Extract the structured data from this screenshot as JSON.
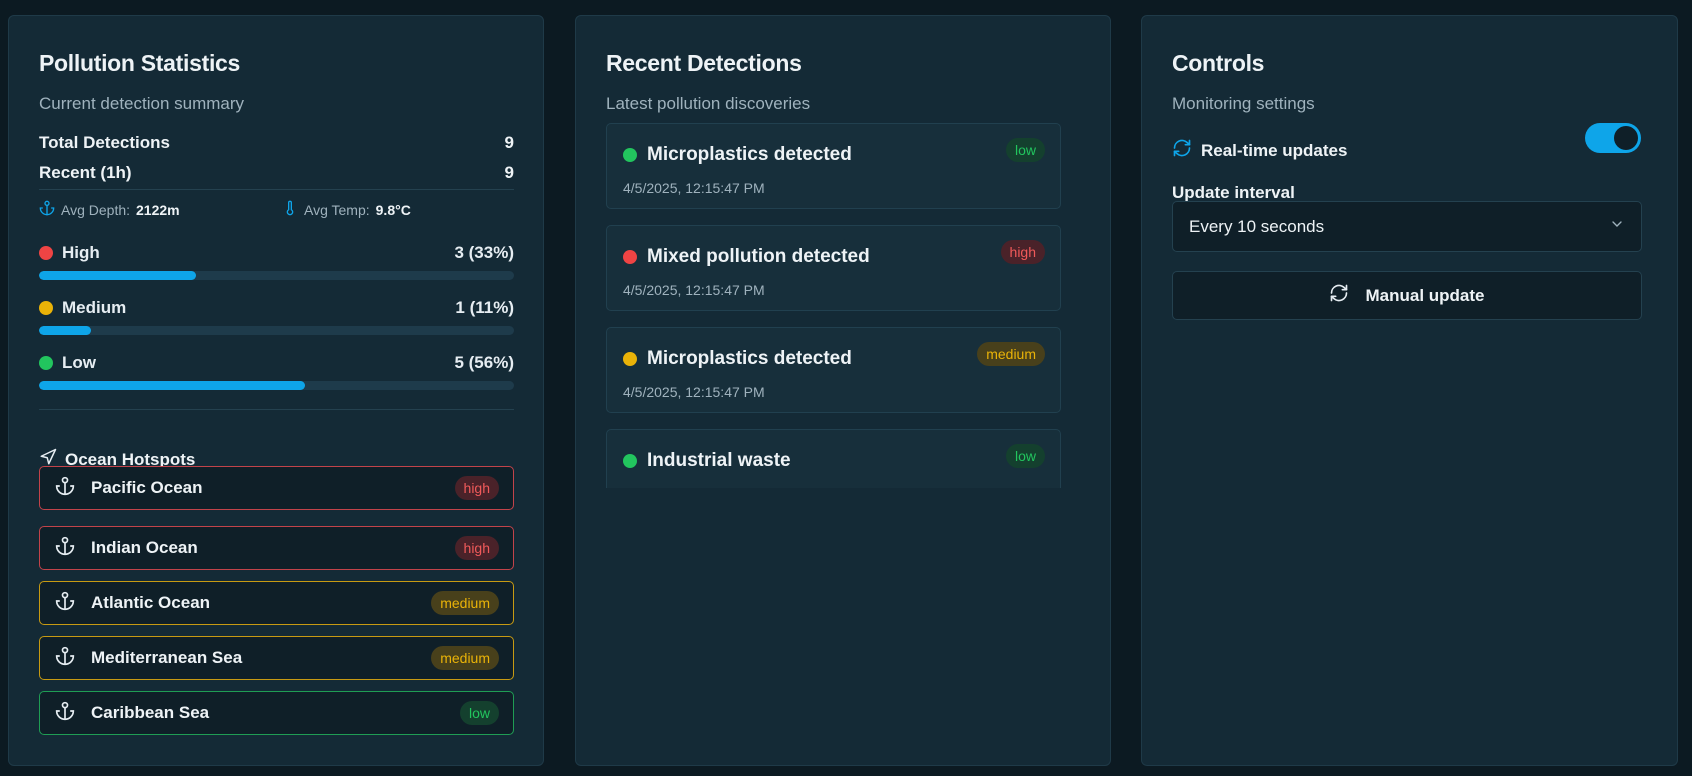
{
  "stats": {
    "title": "Pollution Statistics",
    "subtitle": "Current detection summary",
    "total_label": "Total Detections",
    "total_value": "9",
    "recent_label": "Recent (1h)",
    "recent_value": "9",
    "avg_depth_label": "Avg Depth:",
    "avg_depth_value": "2122m",
    "avg_temp_label": "Avg Temp:",
    "avg_temp_value": "9.8°C",
    "severity": [
      {
        "name": "High",
        "count": "3 (33%)",
        "fraction": 0.33,
        "color": "#ef4444"
      },
      {
        "name": "Medium",
        "count": "1 (11%)",
        "fraction": 0.11,
        "color": "#eab308"
      },
      {
        "name": "Low",
        "count": "5 (56%)",
        "fraction": 0.56,
        "color": "#22c55e"
      }
    ],
    "hotspots_title": "Ocean Hotspots",
    "hotspots": [
      {
        "name": "Pacific Ocean",
        "level": "high"
      },
      {
        "name": "Indian Ocean",
        "level": "high"
      },
      {
        "name": "Atlantic Ocean",
        "level": "medium"
      },
      {
        "name": "Mediterranean Sea",
        "level": "medium"
      },
      {
        "name": "Caribbean Sea",
        "level": "low"
      }
    ]
  },
  "detections": {
    "title": "Recent Detections",
    "subtitle": "Latest pollution discoveries",
    "items": [
      {
        "title": "Microplastics detected",
        "time": "4/5/2025, 12:15:47 PM",
        "level": "low"
      },
      {
        "title": "Mixed pollution detected",
        "time": "4/5/2025, 12:15:47 PM",
        "level": "high"
      },
      {
        "title": "Microplastics detected",
        "time": "4/5/2025, 12:15:47 PM",
        "level": "medium"
      },
      {
        "title": "Industrial waste",
        "time": "",
        "level": "low"
      }
    ]
  },
  "controls": {
    "title": "Controls",
    "subtitle": "Monitoring settings",
    "realtime_label": "Real-time updates",
    "realtime_on": true,
    "interval_label": "Update interval",
    "interval_value": "Every 10 seconds",
    "manual_label": "Manual update"
  },
  "colors": {
    "accent": "#0ea5e9",
    "high": "#ef4444",
    "medium": "#eab308",
    "low": "#22c55e"
  }
}
